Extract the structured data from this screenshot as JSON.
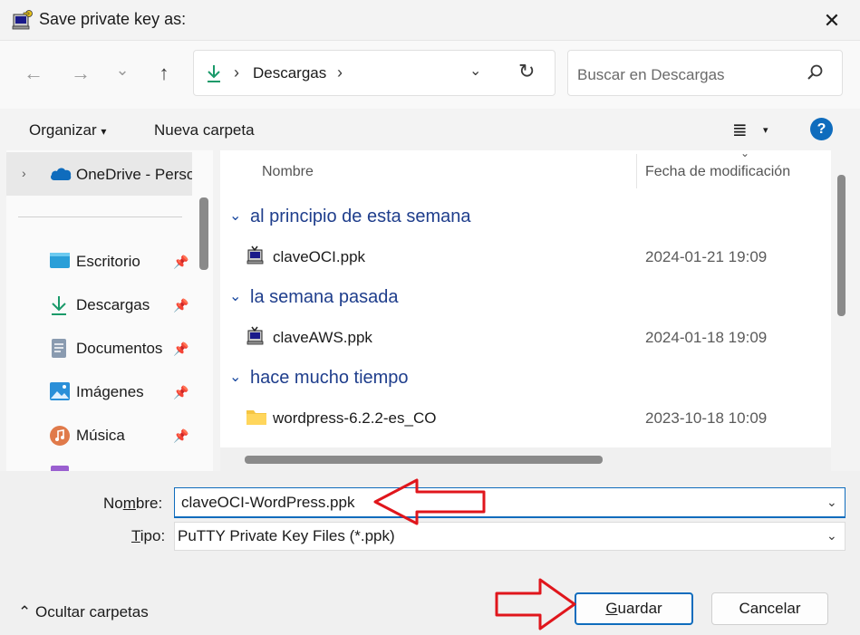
{
  "window": {
    "title": "Save private key as:",
    "close_glyph": "✕"
  },
  "navigation": {
    "back_glyph": "←",
    "forward_glyph": "→",
    "recent_glyph": "⌄",
    "up_glyph": "↑",
    "breadcrumb_separator": "›",
    "location": "Descargas",
    "location_dropdown_glyph": "⌄",
    "refresh_glyph": "↻",
    "search_placeholder": "Buscar en Descargas"
  },
  "commandbar": {
    "organize_label": "Organizar",
    "organize_caret": "▾",
    "new_folder_label": "Nueva carpeta",
    "view_glyph": "≣",
    "view_caret": "▾",
    "help_glyph": "?"
  },
  "sidebar": {
    "onedrive_label": "OneDrive - Personal",
    "expand_glyph": "›",
    "pin_glyph": "📌",
    "items": [
      {
        "label": "Escritorio",
        "icon": "desktop-icon"
      },
      {
        "label": "Descargas",
        "icon": "download-icon"
      },
      {
        "label": "Documentos",
        "icon": "document-icon"
      },
      {
        "label": "Imágenes",
        "icon": "pictures-icon"
      },
      {
        "label": "Música",
        "icon": "music-icon"
      }
    ]
  },
  "filelist": {
    "columns": {
      "name": "Nombre",
      "date": "Fecha de modificación"
    },
    "sort_glyph": "⌄",
    "group_chevron": "⌄",
    "groups": [
      {
        "label": "al principio de esta semana",
        "files": [
          {
            "name": "claveOCI.ppk",
            "date": "2024-01-21 19:09",
            "icon": "putty-key-icon"
          }
        ]
      },
      {
        "label": "la semana pasada",
        "files": [
          {
            "name": "claveAWS.ppk",
            "date": "2024-01-18 19:09",
            "icon": "putty-key-icon"
          }
        ]
      },
      {
        "label": "hace mucho tiempo",
        "files": [
          {
            "name": "wordpress-6.2.2-es_CO",
            "date": "2023-10-18 10:09",
            "icon": "folder-icon"
          }
        ]
      }
    ]
  },
  "form": {
    "name_label_prefix": "No",
    "name_label_underlined": "m",
    "name_label_suffix": "bre:",
    "name_value": "claveOCI-WordPress.ppk",
    "type_label_prefix": "",
    "type_label_underlined": "T",
    "type_label_suffix": "ipo:",
    "type_value": "PuTTY Private Key Files (*.ppk)",
    "dropdown_glyph": "⌄"
  },
  "footer": {
    "hide_folders_caret": "⌃",
    "hide_folders_label": "Ocultar carpetas",
    "save_underlined": "G",
    "save_rest": "uardar",
    "cancel_label": "Cancelar"
  },
  "colors": {
    "accent": "#0f6cbd",
    "annotation_arrow": "#e0161c",
    "group_header": "#1f3e8c"
  }
}
